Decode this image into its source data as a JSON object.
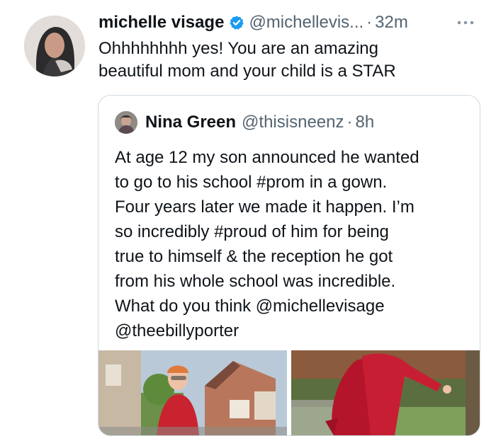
{
  "tweet": {
    "author": {
      "name": "michelle visage",
      "handle": "@michellevis...",
      "verified": true,
      "avatar": "profile-photo"
    },
    "separator": "·",
    "time": "32m",
    "more_icon": "more-horizontal-icon",
    "text_lines": [
      "Ohhhhhhhh yes! You are an amazing",
      "beautiful mom and your child is a STAR"
    ],
    "quoted": {
      "author": {
        "name": "Nina Green",
        "handle": "@thisisneenz",
        "avatar": "profile-photo"
      },
      "separator": "·",
      "time": "8h",
      "text_lines": [
        "At age 12 my son announced he wanted",
        "to go to his school #prom in a gown.",
        "Four years later we made it happen. I’m",
        "so incredibly #proud of him for being",
        "true to himself & the reception he got",
        "from his whole school was incredible.",
        "What do you think @michellevisage",
        "@theebillyporter"
      ],
      "media": [
        "photo",
        "photo"
      ]
    }
  },
  "colors": {
    "text": "#0f1419",
    "secondary": "#536471",
    "verified": "#1d9bf0",
    "border": "#cfd9de"
  }
}
